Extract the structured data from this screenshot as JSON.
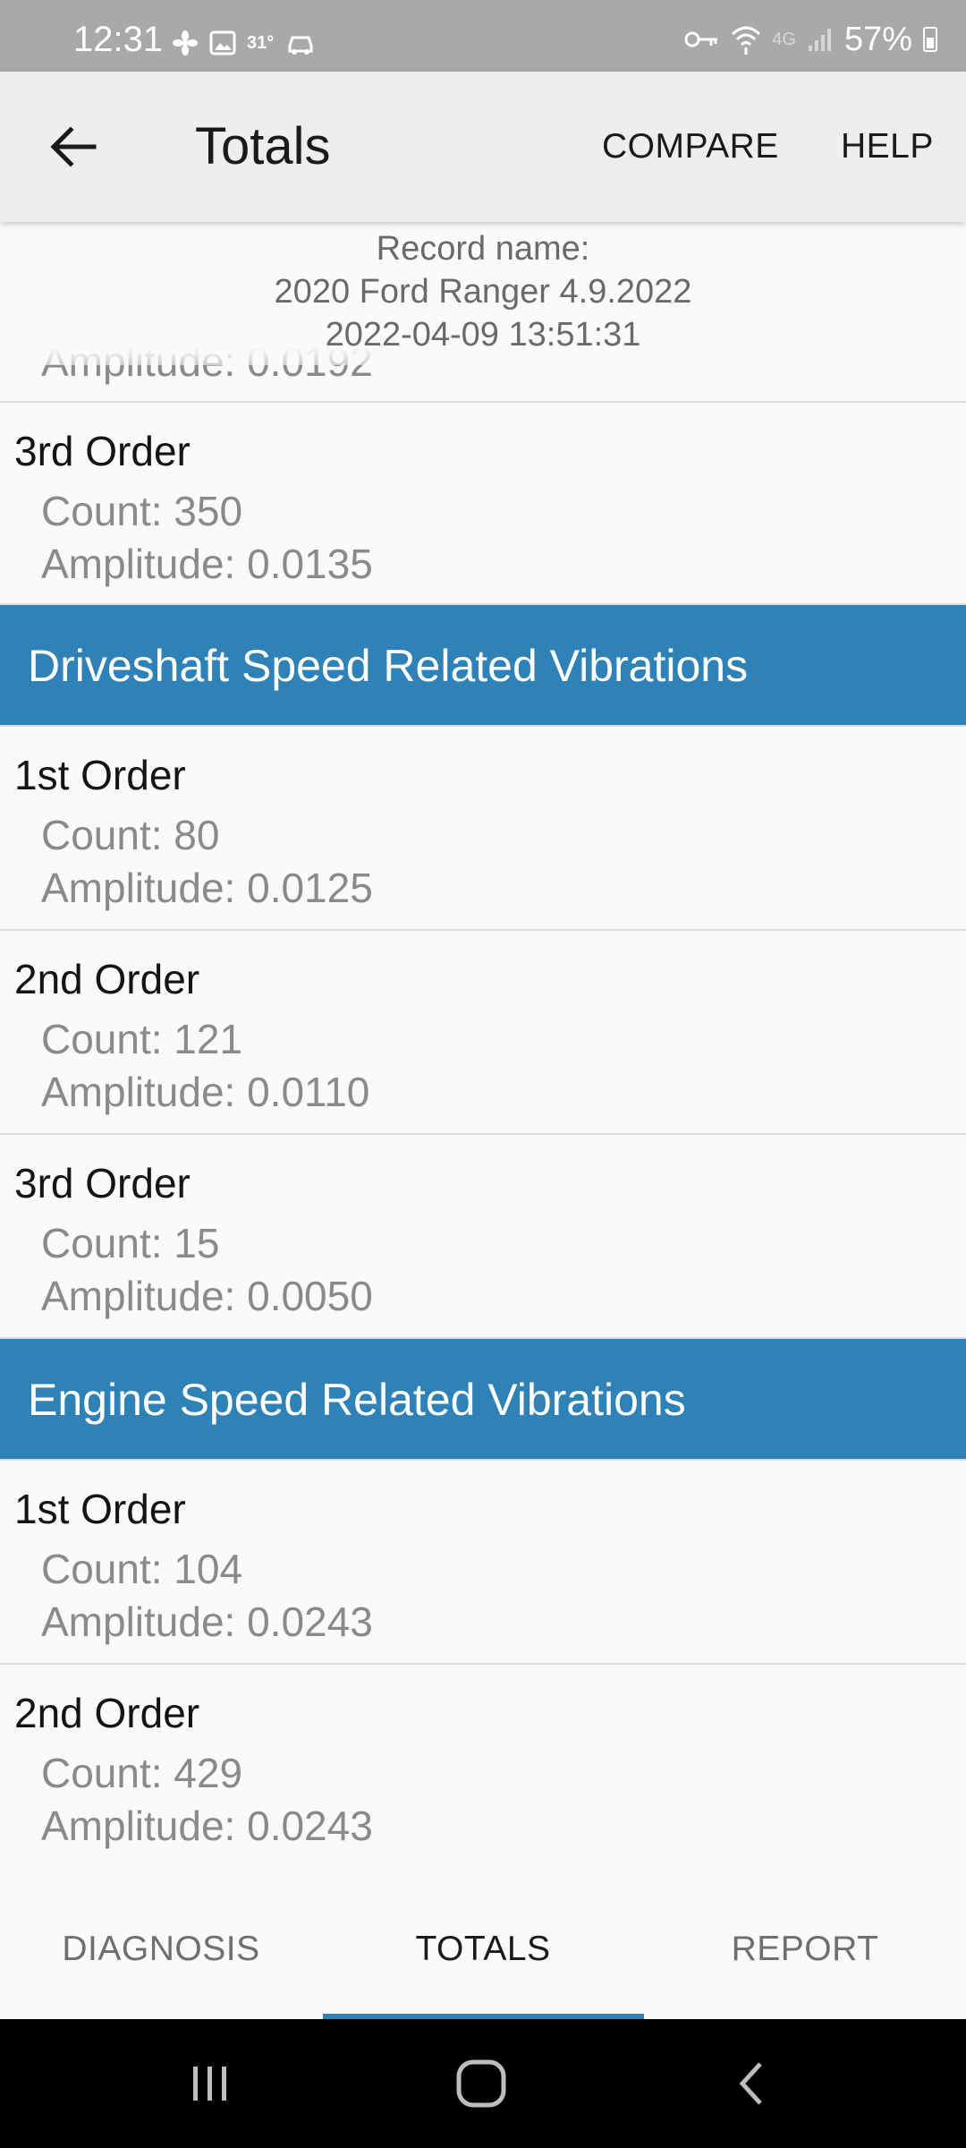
{
  "status_bar": {
    "time": "12:31",
    "temperature": "31°",
    "network": "4G",
    "battery": "57%",
    "icons": [
      "fan-icon",
      "image-icon",
      "car-icon",
      "key-icon",
      "wifi-icon",
      "signal-icon",
      "battery-icon"
    ]
  },
  "toolbar": {
    "back_icon": "arrow-left-icon",
    "title": "Totals",
    "compare_label": "COMPARE",
    "help_label": "HELP"
  },
  "record": {
    "label": "Record name:",
    "name": "2020 Ford Ranger 4.9.2022",
    "timestamp": "2022-04-09 13:51:31"
  },
  "partial_row": {
    "amplitude": "Amplitude: 0.0192"
  },
  "rows_top": [
    {
      "title": "3rd Order",
      "count": "Count: 350",
      "amplitude": "Amplitude: 0.0135"
    }
  ],
  "sections": [
    {
      "title": "Driveshaft Speed Related Vibrations",
      "rows": [
        {
          "title": "1st Order",
          "count": "Count: 80",
          "amplitude": "Amplitude: 0.0125"
        },
        {
          "title": "2nd Order",
          "count": "Count: 121",
          "amplitude": "Amplitude: 0.0110"
        },
        {
          "title": "3rd Order",
          "count": "Count: 15",
          "amplitude": "Amplitude: 0.0050"
        }
      ]
    },
    {
      "title": "Engine Speed Related Vibrations",
      "rows": [
        {
          "title": "1st Order",
          "count": "Count: 104",
          "amplitude": "Amplitude: 0.0243"
        },
        {
          "title": "2nd Order",
          "count": "Count: 429",
          "amplitude": "Amplitude: 0.0243"
        }
      ]
    }
  ],
  "tabs": [
    {
      "label": "DIAGNOSIS",
      "active": false
    },
    {
      "label": "TOTALS",
      "active": true
    },
    {
      "label": "REPORT",
      "active": false
    }
  ],
  "colors": {
    "section_header": "#2e82b8",
    "tab_indicator": "#2e82b8",
    "status_bar": "#a9a9a9",
    "toolbar": "#eeeeee"
  },
  "nav_bar": {
    "icons": [
      "recent-apps-icon",
      "home-icon",
      "back-icon"
    ]
  }
}
